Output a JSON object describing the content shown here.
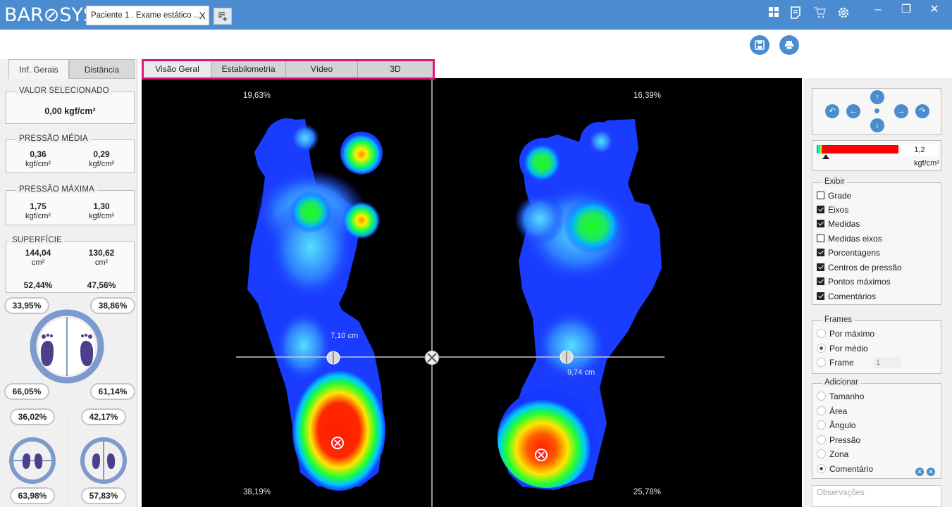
{
  "app": {
    "logo": "BAR⊘SYS",
    "doc_tab": "Paciente 1 . Exame estático ...",
    "doc_tab_close": "X"
  },
  "title_icons": [
    "grid-view-icon",
    "report-icon",
    "cart-icon",
    "settings-icon"
  ],
  "window": {
    "minimize": "–",
    "restore": "❐",
    "close": "✕"
  },
  "toolbar": {
    "save_icon": "save-icon",
    "print_icon": "print-icon"
  },
  "left_tabs": {
    "tab1": "Inf. Gerais",
    "tab2": "Distância"
  },
  "selected": {
    "title": "VALOR SELECIONADO",
    "value": "0,00 kgf/cm²"
  },
  "pressao_media": {
    "title": "PRESSÃO MÉDIA",
    "left": "0,36",
    "right": "0,29",
    "unit": "kgf/cm²"
  },
  "pressao_maxima": {
    "title": "PRESSÃO MÁXIMA",
    "left": "1,75",
    "right": "1,30",
    "unit": "kgf/cm²"
  },
  "superficie": {
    "title": "SUPERFÍCIE",
    "left": "144,04",
    "right": "130,62",
    "unit": "cm²",
    "left_pct": "52,44%",
    "right_pct": "47,56%"
  },
  "distribution": {
    "top_left": "33,95%",
    "top_right": "38,86%",
    "bottom_left": "66,05%",
    "bottom_right": "61,14%",
    "left_top": "36,02%",
    "right_top": "42,17%",
    "left_bottom": "63,98%",
    "right_bottom": "57,83%"
  },
  "view_tabs": [
    "Visão Geral",
    "Estabilometria",
    "Vídeo",
    "3D"
  ],
  "canvas": {
    "pct_tl": "19,63%",
    "pct_tr": "16,39%",
    "pct_bl": "38,19%",
    "pct_br": "25,78%",
    "meas_left": "7,10 cm",
    "meas_right": "9,74 cm"
  },
  "scale": {
    "value": "1,2",
    "unit": "kgf/cm²",
    "level": 0.0
  },
  "exibir": {
    "title": "Exibir",
    "items": [
      {
        "label": "Grade",
        "checked": false
      },
      {
        "label": "Eixos",
        "checked": true
      },
      {
        "label": "Medidas",
        "checked": true
      },
      {
        "label": "Medidas eixos",
        "checked": false
      },
      {
        "label": "Porcentagens",
        "checked": true
      },
      {
        "label": "Centros de pressão",
        "checked": true
      },
      {
        "label": "Pontos máximos",
        "checked": true
      },
      {
        "label": "Comentários",
        "checked": true
      }
    ]
  },
  "frames": {
    "title": "Frames",
    "items": [
      {
        "label": "Por máximo",
        "selected": false
      },
      {
        "label": "Por médio",
        "selected": true
      },
      {
        "label": "Frame",
        "selected": false
      }
    ],
    "frame_value": "1"
  },
  "adicionar": {
    "title": "Adicionar",
    "items": [
      {
        "label": "Tamanho",
        "selected": false
      },
      {
        "label": "Área",
        "selected": false
      },
      {
        "label": "Ângulo",
        "selected": false
      },
      {
        "label": "Pressão",
        "selected": false
      },
      {
        "label": "Zona",
        "selected": false
      },
      {
        "label": "Comentário",
        "selected": true
      }
    ]
  },
  "observacoes": {
    "placeholder": "Observações"
  }
}
